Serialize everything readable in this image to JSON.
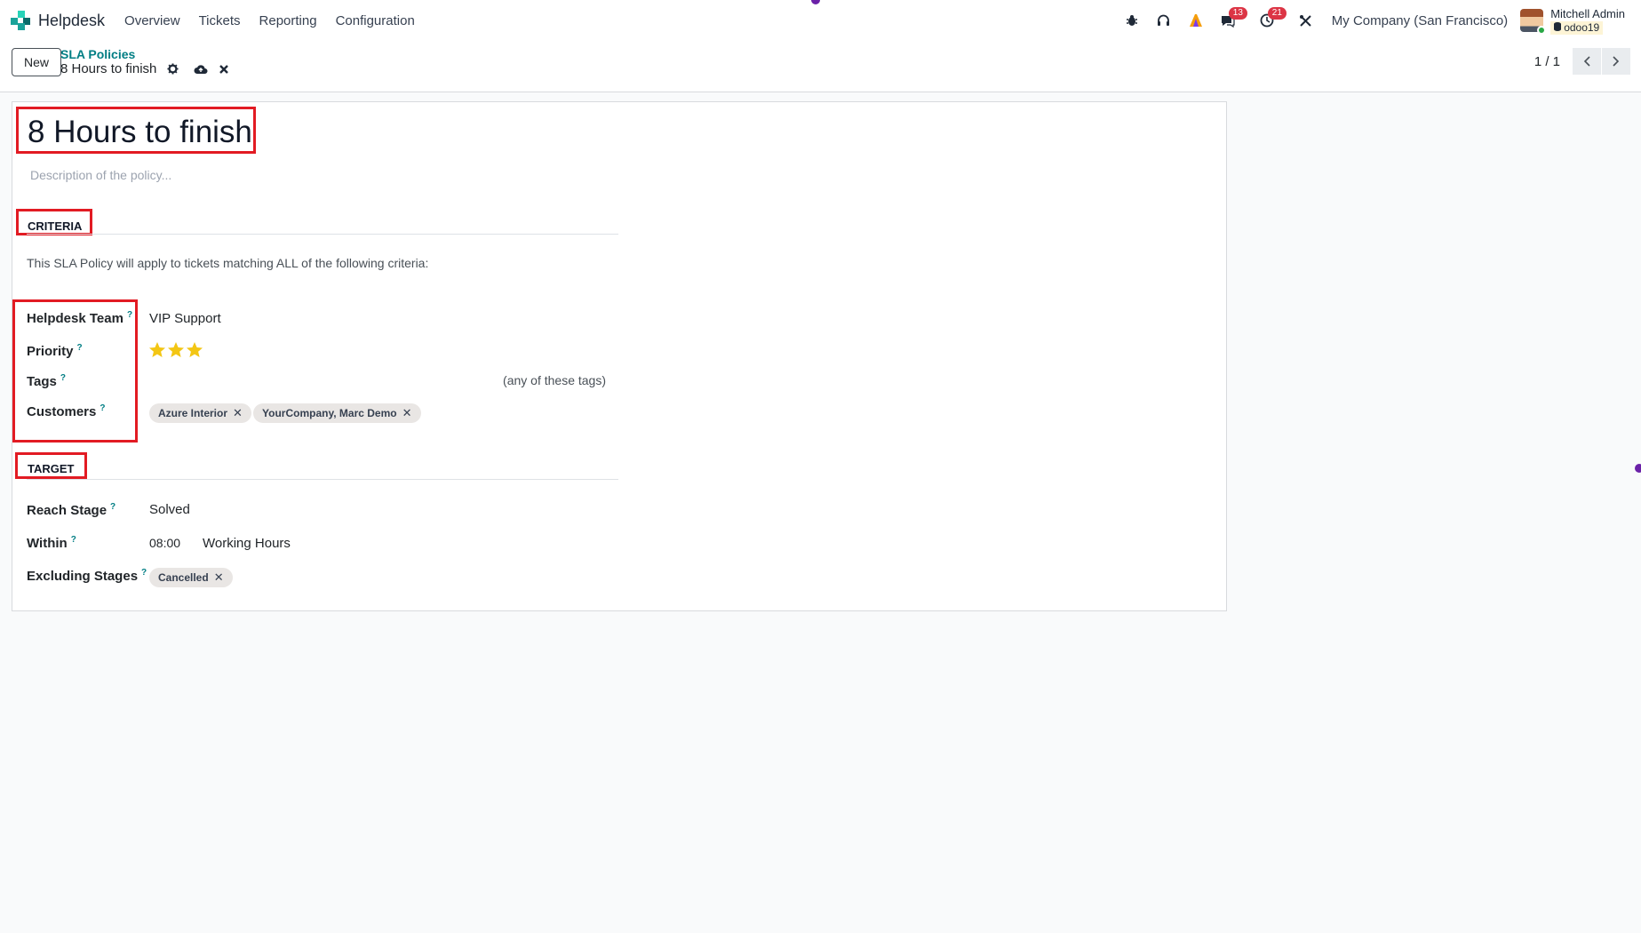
{
  "navbar": {
    "app_name": "Helpdesk",
    "menu": [
      "Overview",
      "Tickets",
      "Reporting",
      "Configuration"
    ],
    "chat_count": "13",
    "activity_count": "21",
    "company": "My Company (San Francisco)",
    "user_name": "Mitchell Admin",
    "database": "odoo19"
  },
  "control_panel": {
    "new_label": "New",
    "breadcrumb_parent": "SLA Policies",
    "breadcrumb_current": "8 Hours to finish",
    "pager": "1 / 1"
  },
  "form": {
    "title": "8 Hours to finish",
    "description_placeholder": "Description of the policy...",
    "criteria_heading": "CRITERIA",
    "criteria_note": "This SLA Policy will apply to tickets matching ALL of the following criteria:",
    "helpdesk_team_label": "Helpdesk Team",
    "helpdesk_team_value": "VIP Support",
    "priority_label": "Priority",
    "priority_stars_filled": 3,
    "priority_stars_total": 3,
    "tags_label": "Tags",
    "tags_hint": "(any of these tags)",
    "customers_label": "Customers",
    "customers": [
      "Azure Interior",
      "YourCompany, Marc Demo"
    ],
    "target_heading": "TARGET",
    "reach_stage_label": "Reach Stage",
    "reach_stage_value": "Solved",
    "within_label": "Within",
    "within_time": "08:00",
    "within_unit": "Working Hours",
    "excluding_stages_label": "Excluding Stages",
    "excluding_stages": [
      "Cancelled"
    ],
    "help_marker": "?"
  },
  "colors": {
    "accent": "#017e84",
    "highlight": "#e21b23",
    "star": "#f3c614",
    "badge": "#dc3545"
  }
}
